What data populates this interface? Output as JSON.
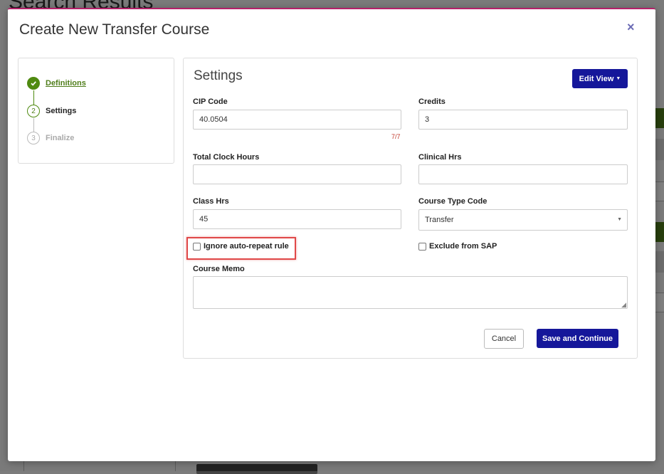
{
  "background": {
    "page_title": "Search Results"
  },
  "modal": {
    "title": "Create New Transfer Course",
    "close_label": "×"
  },
  "steps": [
    {
      "number": "1",
      "label": "Definitions",
      "state": "done"
    },
    {
      "number": "2",
      "label": "Settings",
      "state": "active"
    },
    {
      "number": "3",
      "label": "Finalize",
      "state": "pending"
    }
  ],
  "settings": {
    "title": "Settings",
    "edit_view_label": "Edit View",
    "fields": {
      "cip_code": {
        "label": "CIP Code",
        "value": "40.0504",
        "counter": "7/7"
      },
      "credits": {
        "label": "Credits",
        "value": "3"
      },
      "total_clock_hours": {
        "label": "Total Clock Hours",
        "value": ""
      },
      "clinical_hrs": {
        "label": "Clinical Hrs",
        "value": ""
      },
      "class_hrs": {
        "label": "Class Hrs",
        "value": "45"
      },
      "course_type_code": {
        "label": "Course Type Code",
        "value": "Transfer"
      },
      "ignore_auto_repeat": {
        "label": "Ignore auto-repeat rule",
        "checked": false
      },
      "exclude_from_sap": {
        "label": "Exclude from SAP",
        "checked": false
      },
      "course_memo": {
        "label": "Course Memo",
        "value": ""
      }
    },
    "cancel_label": "Cancel",
    "save_label": "Save and Continue"
  },
  "colors": {
    "primary": "#15179a",
    "success": "#4f8a10",
    "accent_top": "#b5206a",
    "highlight": "#e04848"
  }
}
